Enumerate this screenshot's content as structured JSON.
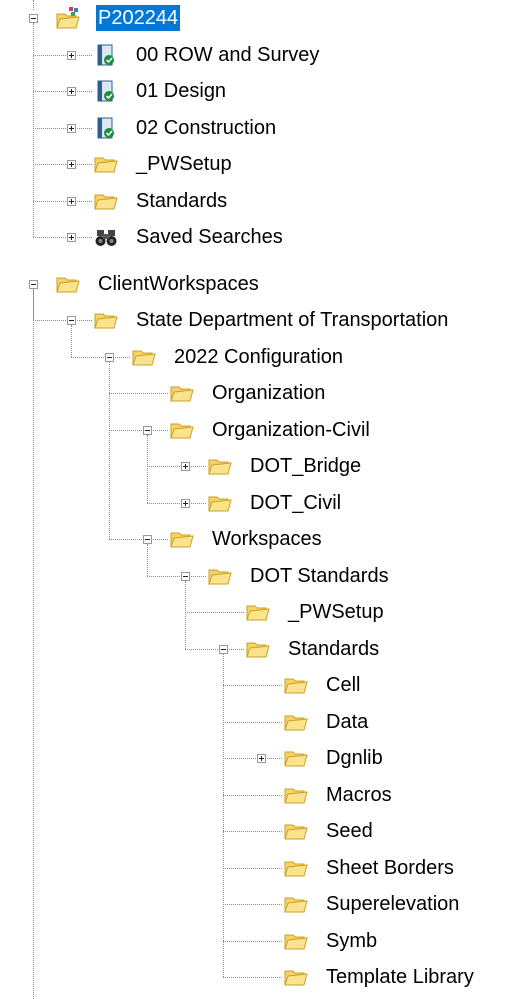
{
  "tree": {
    "nodes": [
      {
        "level": 0,
        "label": "P202244",
        "icon": "project-root-icon",
        "expander": "minus",
        "selected": true
      },
      {
        "level": 1,
        "label": "00 ROW and Survey",
        "icon": "workspace-doc-icon",
        "expander": "plus"
      },
      {
        "level": 1,
        "label": "01 Design",
        "icon": "workspace-doc-icon",
        "expander": "plus"
      },
      {
        "level": 1,
        "label": "02 Construction",
        "icon": "workspace-doc-icon",
        "expander": "plus"
      },
      {
        "level": 1,
        "label": "_PWSetup",
        "icon": "folder-icon",
        "expander": "plus"
      },
      {
        "level": 1,
        "label": "Standards",
        "icon": "folder-icon",
        "expander": "plus"
      },
      {
        "level": 1,
        "label": "Saved Searches",
        "icon": "binoculars-icon",
        "expander": "plus"
      },
      {
        "level": 0,
        "label": "ClientWorkspaces",
        "icon": "folder-icon",
        "expander": "minus"
      },
      {
        "level": 1,
        "label": "State Department of Transportation",
        "icon": "folder-icon",
        "expander": "minus"
      },
      {
        "level": 2,
        "label": "2022 Configuration",
        "icon": "folder-icon",
        "expander": "minus"
      },
      {
        "level": 3,
        "label": "Organization",
        "icon": "folder-icon",
        "expander": "none"
      },
      {
        "level": 3,
        "label": "Organization-Civil",
        "icon": "folder-icon",
        "expander": "minus"
      },
      {
        "level": 4,
        "label": "DOT_Bridge",
        "icon": "folder-icon",
        "expander": "plus"
      },
      {
        "level": 4,
        "label": "DOT_Civil",
        "icon": "folder-icon",
        "expander": "plus"
      },
      {
        "level": 3,
        "label": "Workspaces",
        "icon": "folder-icon",
        "expander": "minus"
      },
      {
        "level": 4,
        "label": "DOT Standards",
        "icon": "folder-icon",
        "expander": "minus"
      },
      {
        "level": 5,
        "label": "_PWSetup",
        "icon": "folder-icon",
        "expander": "none"
      },
      {
        "level": 5,
        "label": "Standards",
        "icon": "folder-icon",
        "expander": "minus"
      },
      {
        "level": 6,
        "label": "Cell",
        "icon": "folder-icon",
        "expander": "none"
      },
      {
        "level": 6,
        "label": "Data",
        "icon": "folder-icon",
        "expander": "none"
      },
      {
        "level": 6,
        "label": "Dgnlib",
        "icon": "folder-icon",
        "expander": "plus"
      },
      {
        "level": 6,
        "label": "Macros",
        "icon": "folder-icon",
        "expander": "none"
      },
      {
        "level": 6,
        "label": "Seed",
        "icon": "folder-icon",
        "expander": "none"
      },
      {
        "level": 6,
        "label": "Sheet Borders",
        "icon": "folder-icon",
        "expander": "none"
      },
      {
        "level": 6,
        "label": "Superelevation",
        "icon": "folder-icon",
        "expander": "none"
      },
      {
        "level": 6,
        "label": "Symb",
        "icon": "folder-icon",
        "expander": "none"
      },
      {
        "level": 6,
        "label": "Template Library",
        "icon": "folder-icon",
        "expander": "none"
      }
    ]
  },
  "colors": {
    "selection": "#0078d7",
    "folder": "#f6d365",
    "folder_edge": "#c9a227"
  }
}
